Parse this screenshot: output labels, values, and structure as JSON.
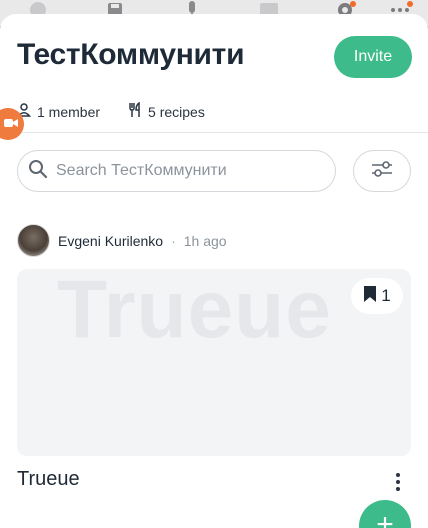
{
  "colors": {
    "accent": "#3dbb8a",
    "badge": "#f26b2a",
    "side_tab": "#f07b3f"
  },
  "top_strip": {
    "icons": [
      "smiley-icon",
      "save-disk-icon",
      "microphone-icon",
      "image-icon",
      "gear-icon",
      "more-dots-icon"
    ]
  },
  "header": {
    "title": "ТестКоммунити",
    "invite_label": "Invite"
  },
  "stats": {
    "members": "1 member",
    "recipes": "5 recipes"
  },
  "search": {
    "placeholder": "Search ТестКоммунити"
  },
  "post": {
    "author": "Evgeni Kurilenko",
    "separator": "·",
    "time": "1h ago",
    "image_watermark": "Trueue",
    "bookmark_count": "1",
    "title": "Trueue"
  },
  "fab": {
    "label": "+"
  }
}
